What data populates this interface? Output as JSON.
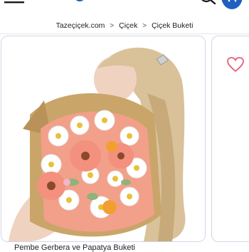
{
  "breadcrumb": {
    "items": [
      "Tazeçiçek.com",
      "Çiçek",
      "Çiçek Buketi"
    ],
    "separator": ">"
  },
  "product": {
    "name_partial": "Pembe Gerbera ve Papatya Buketi"
  },
  "icons": {
    "menu": "hamburger-menu-icon",
    "search": "search-icon",
    "cart": "cart-icon",
    "favorite": "heart-icon"
  },
  "colors": {
    "brand_blue": "#1f5fbf",
    "favorite_pink": "#e0607e",
    "card_border": "#cfd6e6"
  }
}
